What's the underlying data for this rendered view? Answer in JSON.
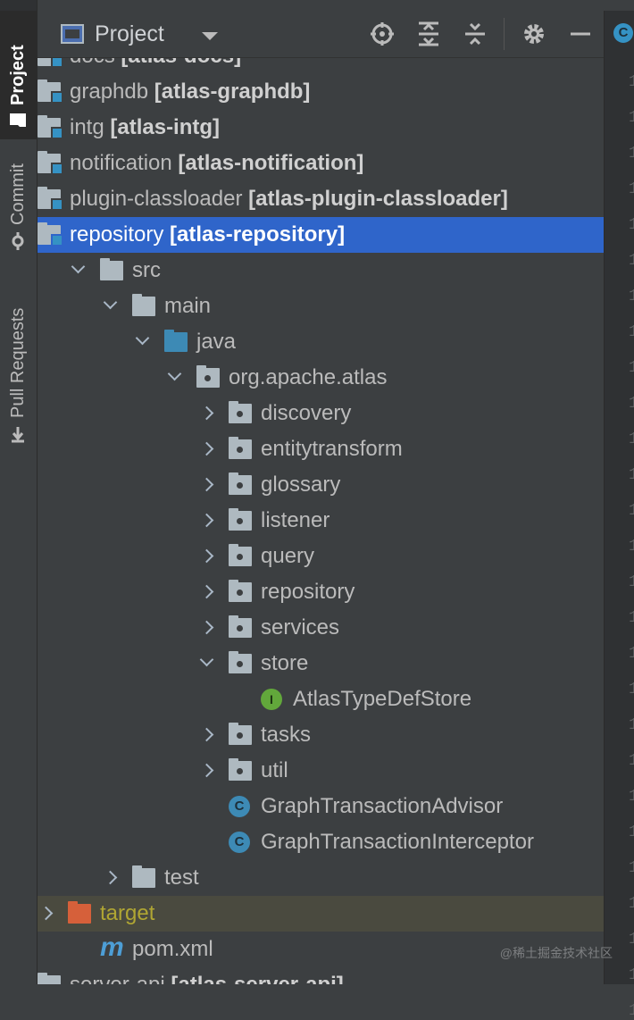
{
  "sidebar": {
    "tabs": [
      {
        "label": "Project",
        "active": true
      },
      {
        "label": "Commit",
        "active": false
      },
      {
        "label": "Pull Requests",
        "active": false
      }
    ]
  },
  "header": {
    "title": "Project",
    "buttons": [
      "locate-icon",
      "expand-all-icon",
      "collapse-all-icon",
      "gear-icon",
      "minimize-icon"
    ]
  },
  "editor_tab_icon": "C",
  "gutter_digits": [
    "1",
    "1",
    "1",
    "1",
    "1",
    "1",
    "1",
    "1",
    "1",
    "1",
    "1",
    "1",
    "1",
    "1",
    "1",
    "1",
    "1",
    "1",
    "1",
    "1",
    "1",
    "1",
    "1",
    "1",
    "1",
    "1",
    "1"
  ],
  "tree": [
    {
      "depth": 0,
      "arrow": "none",
      "icon": "module",
      "name": "docs",
      "module": "[atlas-docs]"
    },
    {
      "depth": 0,
      "arrow": "none",
      "icon": "module",
      "name": "graphdb",
      "module": "[atlas-graphdb]"
    },
    {
      "depth": 0,
      "arrow": "none",
      "icon": "module",
      "name": "intg",
      "module": "[atlas-intg]"
    },
    {
      "depth": 0,
      "arrow": "none",
      "icon": "module",
      "name": "notification",
      "module": "[atlas-notification]"
    },
    {
      "depth": 0,
      "arrow": "none",
      "icon": "module",
      "name": "plugin-classloader",
      "module": "[atlas-plugin-classloader]"
    },
    {
      "depth": 0,
      "arrow": "none",
      "icon": "module",
      "name": "repository",
      "module": "[atlas-repository]",
      "selected": true
    },
    {
      "depth": 1,
      "arrow": "open",
      "icon": "folder",
      "name": "src"
    },
    {
      "depth": 2,
      "arrow": "open",
      "icon": "folder",
      "name": "main"
    },
    {
      "depth": 3,
      "arrow": "open",
      "icon": "java",
      "name": "java"
    },
    {
      "depth": 4,
      "arrow": "open",
      "icon": "package",
      "name": "org.apache.atlas"
    },
    {
      "depth": 5,
      "arrow": "closed",
      "icon": "package",
      "name": "discovery"
    },
    {
      "depth": 5,
      "arrow": "closed",
      "icon": "package",
      "name": "entitytransform"
    },
    {
      "depth": 5,
      "arrow": "closed",
      "icon": "package",
      "name": "glossary"
    },
    {
      "depth": 5,
      "arrow": "closed",
      "icon": "package",
      "name": "listener"
    },
    {
      "depth": 5,
      "arrow": "closed",
      "icon": "package",
      "name": "query"
    },
    {
      "depth": 5,
      "arrow": "closed",
      "icon": "package",
      "name": "repository"
    },
    {
      "depth": 5,
      "arrow": "closed",
      "icon": "package",
      "name": "services"
    },
    {
      "depth": 5,
      "arrow": "open",
      "icon": "package",
      "name": "store"
    },
    {
      "depth": 6,
      "arrow": "none",
      "icon": "interface",
      "name": "AtlasTypeDefStore"
    },
    {
      "depth": 5,
      "arrow": "closed",
      "icon": "package",
      "name": "tasks"
    },
    {
      "depth": 5,
      "arrow": "closed",
      "icon": "package",
      "name": "util"
    },
    {
      "depth": 5,
      "arrow": "none",
      "icon": "class",
      "name": "GraphTransactionAdvisor"
    },
    {
      "depth": 5,
      "arrow": "none",
      "icon": "class",
      "name": "GraphTransactionInterceptor"
    },
    {
      "depth": 2,
      "arrow": "closed",
      "icon": "folder",
      "name": "test"
    },
    {
      "depth": 0,
      "arrow": "closed",
      "icon": "target",
      "name": "target",
      "excluded": true
    },
    {
      "depth": 1,
      "arrow": "none",
      "icon": "maven",
      "name": "pom.xml"
    },
    {
      "depth": 0,
      "arrow": "none",
      "icon": "module",
      "name": "server-api",
      "module": "[atlas-server-api]"
    }
  ],
  "colors": {
    "selection": "#2f65ca",
    "excluded_text": "#b0a633",
    "module_bold_text": "#d0d0d0",
    "package_folder": "#aeb9c0",
    "java_folder": "#3d8ab5",
    "target_folder": "#d6603a",
    "class_icon": "#3d8ab5",
    "interface_icon": "#62a83b"
  },
  "icon_glyphs": {
    "class": "C",
    "interface": "I",
    "maven": "m"
  },
  "watermark": "@稀土掘金技术社区"
}
